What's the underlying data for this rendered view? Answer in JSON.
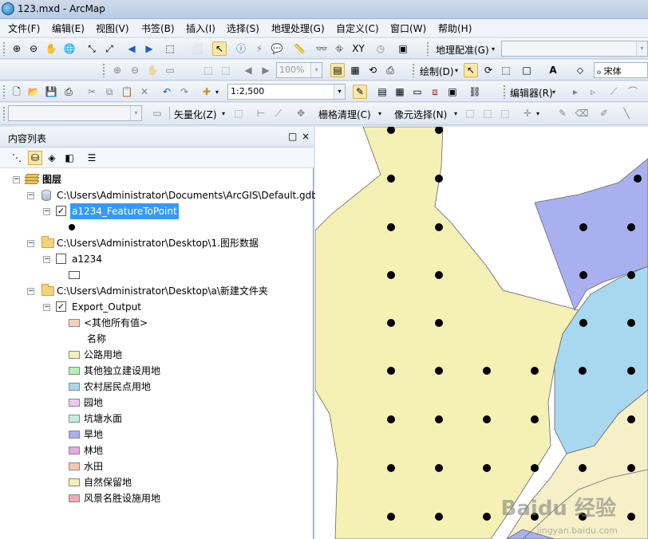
{
  "window": {
    "title": "123.mxd - ArcMap"
  },
  "menu": [
    "文件(F)",
    "编辑(E)",
    "视图(V)",
    "书签(B)",
    "插入(I)",
    "选择(S)",
    "地理处理(G)",
    "自定义(C)",
    "窗口(W)",
    "帮助(H)"
  ],
  "toolbars": {
    "georef_label": "地理配准(G)",
    "zoom_value": "100%",
    "draw_label": "绘制(D)",
    "font_name": "宋体",
    "scale_value": "1:2,500",
    "editor_label": "编辑器(R)",
    "vectorize_label": "矢量化(Z)",
    "raster_cleanup_label": "栅格清理(C)",
    "pixel_select_label": "像元选择(N)"
  },
  "toc": {
    "title": "内容列表",
    "pin": "□",
    "close": "×",
    "root_label": "图层",
    "groups": [
      {
        "path": "C:\\Users\\Administrator\\Documents\\ArcGIS\\Default.gdb",
        "layer": "a1234_FeatureToPoint"
      },
      {
        "path": "C:\\Users\\Administrator\\Desktop\\1.图形数据",
        "layer": "a1234"
      },
      {
        "path": "C:\\Users\\Administrator\\Desktop\\a\\新建文件夹",
        "layer": "Export_Output"
      }
    ],
    "legend_other": "<其他所有值>",
    "legend_field": "名称",
    "legend_items": [
      {
        "label": "公路用地",
        "color": "#f5f0b4"
      },
      {
        "label": "其他独立建设用地",
        "color": "#b4f0b4"
      },
      {
        "label": "农村居民点用地",
        "color": "#a8d8f0"
      },
      {
        "label": "园地",
        "color": "#f0c8f0"
      },
      {
        "label": "坑塘水面",
        "color": "#c0f0e0"
      },
      {
        "label": "旱地",
        "color": "#a8b0f0"
      },
      {
        "label": "林地",
        "color": "#e6a8e6"
      },
      {
        "label": "水田",
        "color": "#f5c8a8"
      },
      {
        "label": "自然保留地",
        "color": "#f5f0b4"
      },
      {
        "label": "风景名胜设施用地",
        "color": "#f0a8b4"
      }
    ],
    "other_color": "#f5d2c0"
  },
  "map_colors": {
    "yellow": "#f5f0b4",
    "blue": "#a8b0f0",
    "cyan": "#a8d8f0",
    "paleyellow": "#f5f0c8"
  },
  "watermark": {
    "main": "Baidu 经验",
    "sub": "jingyan.baidu.com"
  }
}
